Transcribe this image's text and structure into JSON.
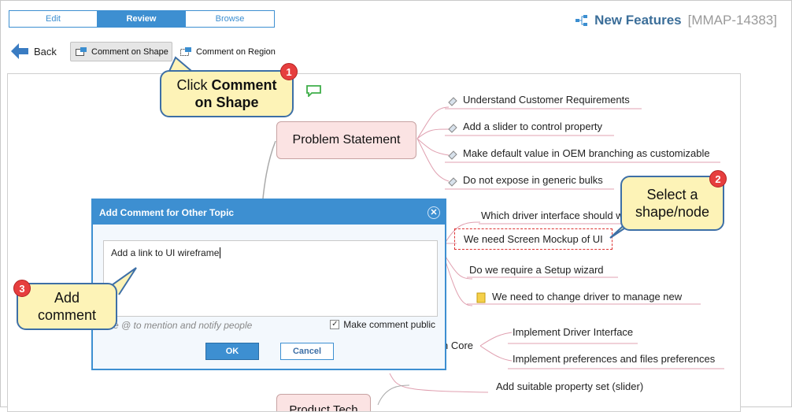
{
  "tabs": [
    "Edit",
    "Review",
    "Browse"
  ],
  "header": {
    "title": "New Features",
    "issue_key": "[MMAP-14383]"
  },
  "toolbar": {
    "back": "Back",
    "comment_shape": "Comment on Shape",
    "comment_region": "Comment on Region"
  },
  "callouts": {
    "c1": {
      "line1": "Click",
      "bold1": "Comment",
      "bold2": "on Shape",
      "badge": "1"
    },
    "c2": {
      "line1": "Select a",
      "line2": "shape/node",
      "badge": "2"
    },
    "c3": {
      "line1": "Add",
      "line2": "comment",
      "badge": "3"
    }
  },
  "map": {
    "topic_problem": "Problem Statement",
    "problem_items": [
      "Understand Customer Requirements",
      "Add a slider to control property",
      "Make default value in OEM branching as customizable",
      "Do not expose in generic bulks"
    ],
    "q1": "Which driver interface should w",
    "selected": "We need Screen Mockup of UI",
    "q3": "Do we require a Setup wizard",
    "q4": "We need to change driver to manage new",
    "core_label": "n Core",
    "core_items": [
      "Implement Driver Interface",
      "Implement preferences and files preferences"
    ],
    "slider_item": "Add suitable property set (slider)",
    "bottom_partial": "Product Tech"
  },
  "dialog": {
    "title": "Add Comment for Other Topic",
    "text": "Add a link to UI wireframe",
    "hint": "e @ to mention and notify people",
    "public_label": "Make comment public",
    "ok": "OK",
    "cancel": "Cancel"
  },
  "colors": {
    "accent": "#3d8fd1",
    "callout_bg": "#fdf3b7",
    "badge": "#e63e3e",
    "topic_bg": "#fbe3e3"
  }
}
